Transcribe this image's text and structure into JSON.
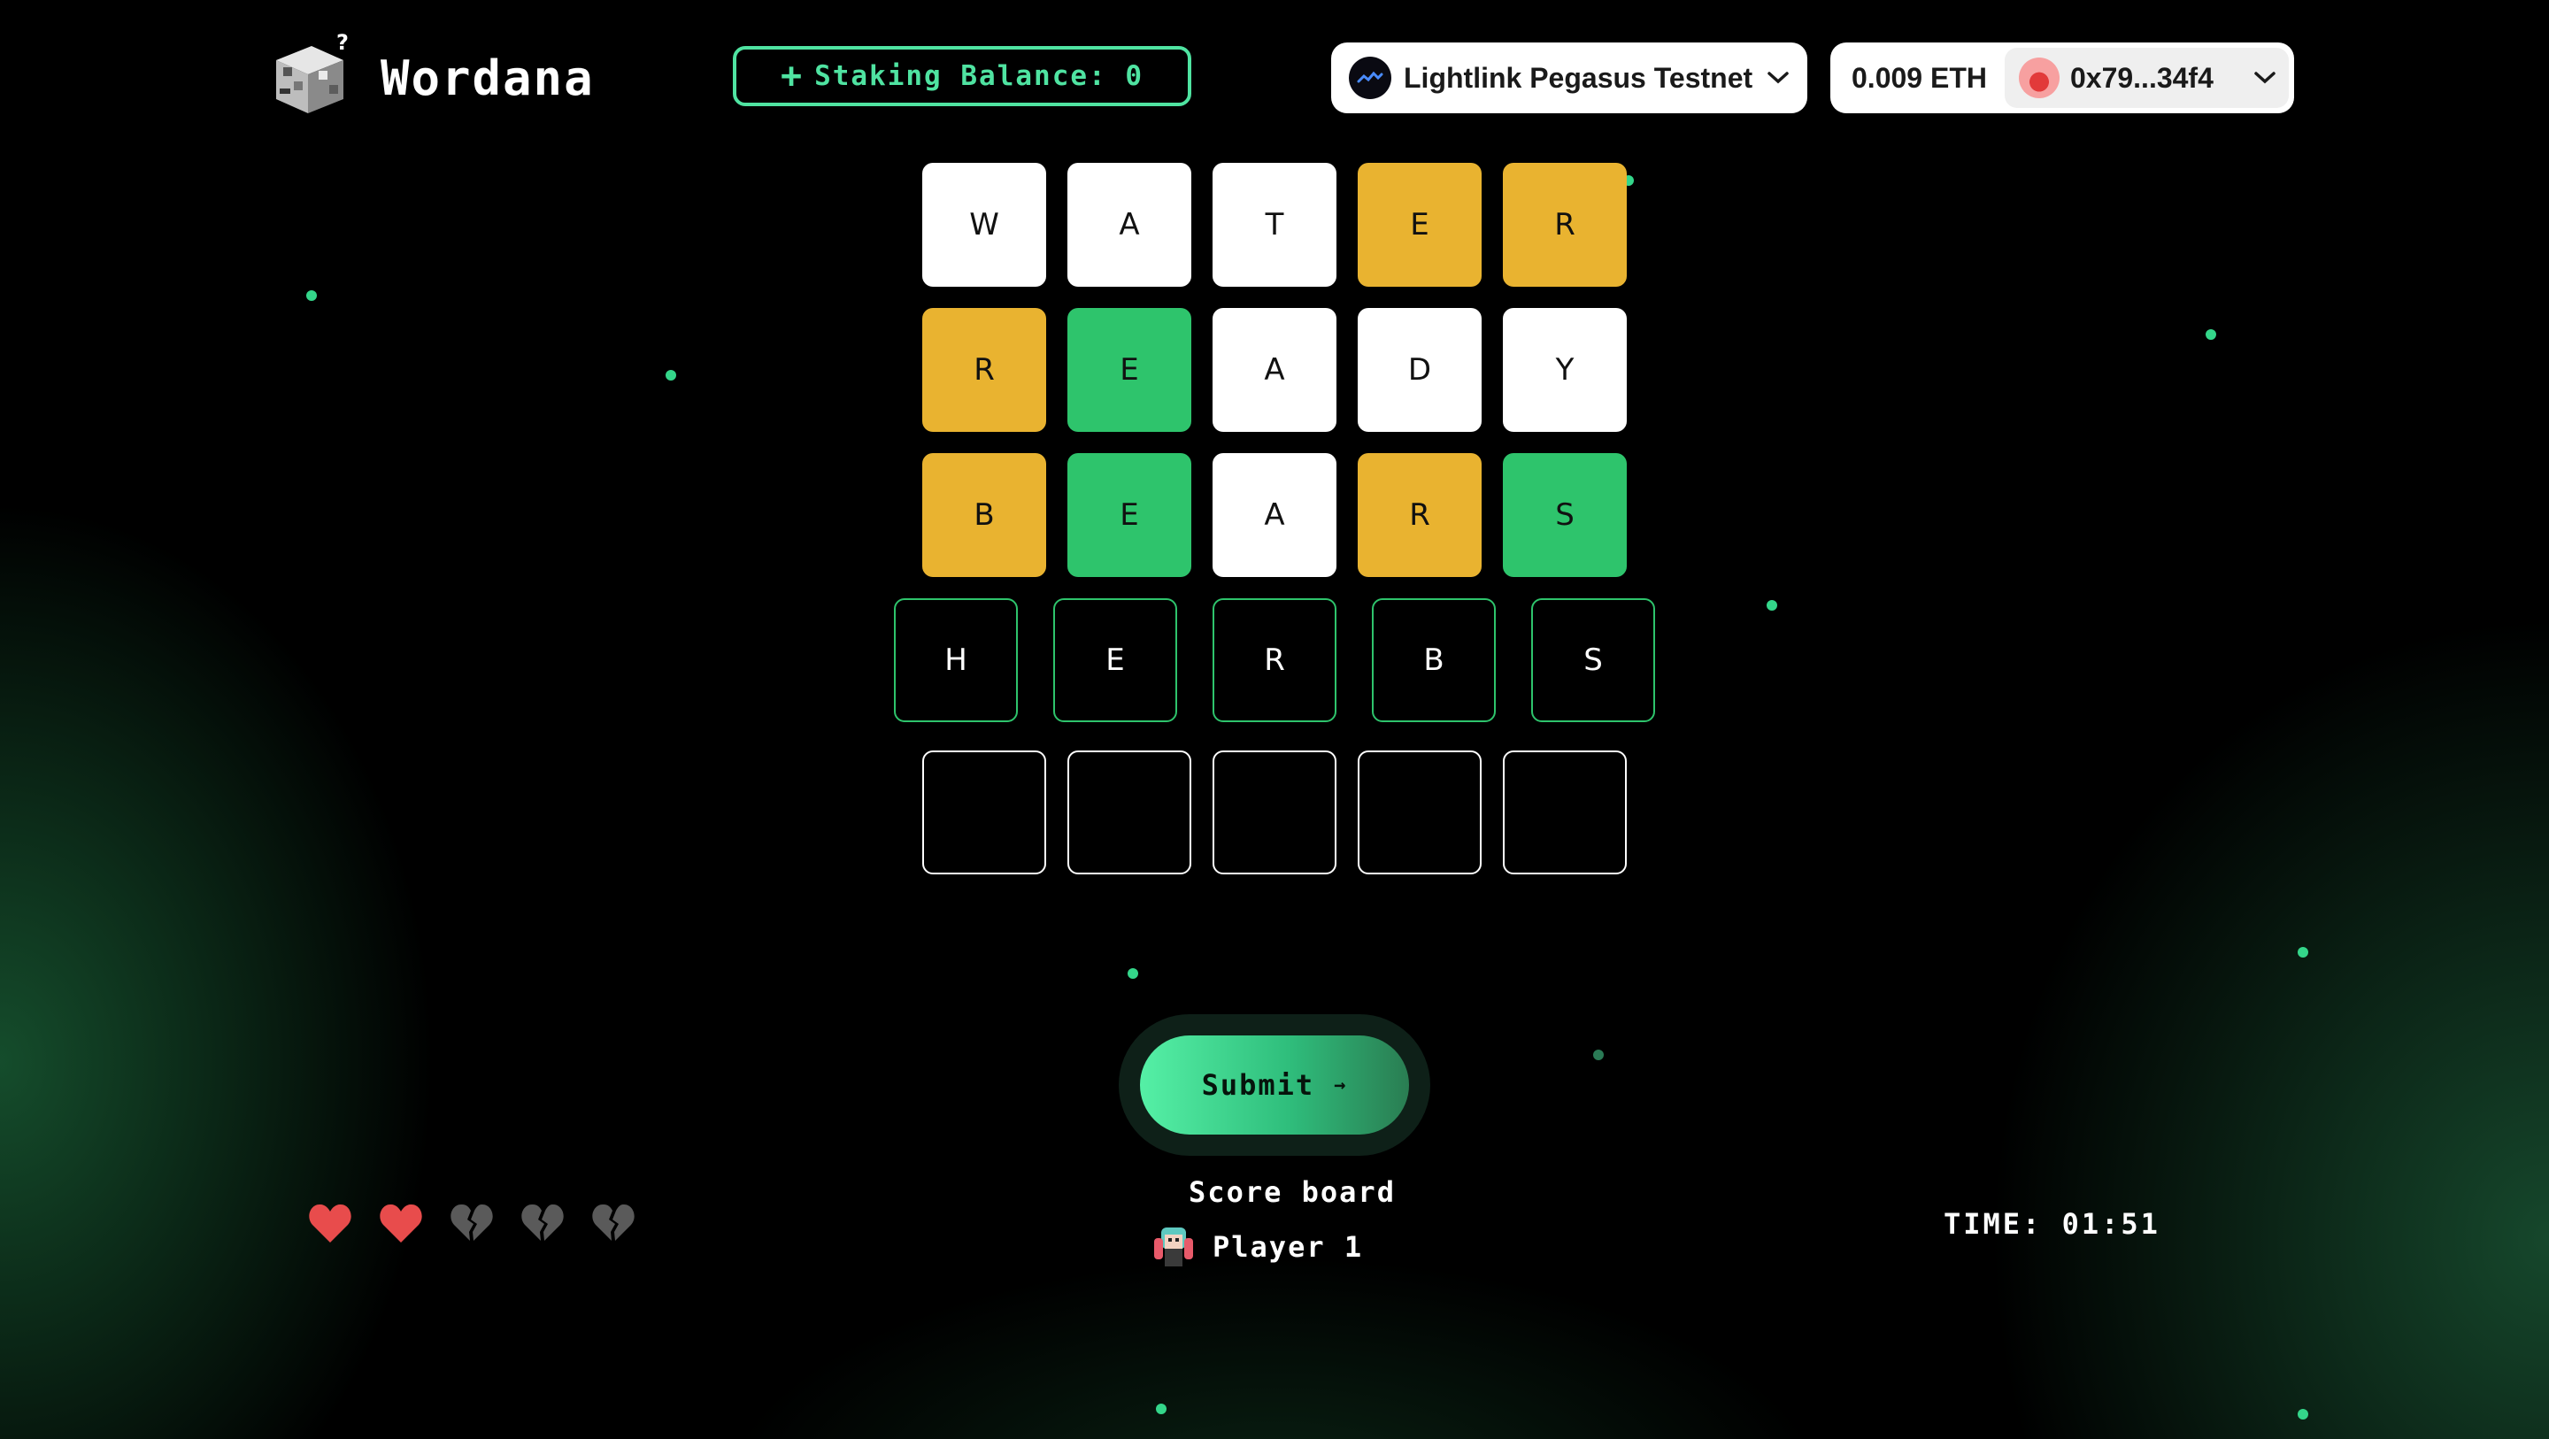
{
  "header": {
    "logo_text": "Wordana",
    "staking_label": "Staking Balance: 0",
    "network_name": "Lightlink Pegasus Testnet",
    "balance": "0.009 ETH",
    "account": "0x79...34f4"
  },
  "board": {
    "rows": [
      [
        {
          "letter": "W",
          "state": "white"
        },
        {
          "letter": "A",
          "state": "white"
        },
        {
          "letter": "T",
          "state": "white"
        },
        {
          "letter": "E",
          "state": "yellow"
        },
        {
          "letter": "R",
          "state": "yellow"
        }
      ],
      [
        {
          "letter": "R",
          "state": "yellow"
        },
        {
          "letter": "E",
          "state": "green"
        },
        {
          "letter": "A",
          "state": "white"
        },
        {
          "letter": "D",
          "state": "white"
        },
        {
          "letter": "Y",
          "state": "white"
        }
      ],
      [
        {
          "letter": "B",
          "state": "yellow"
        },
        {
          "letter": "E",
          "state": "green"
        },
        {
          "letter": "A",
          "state": "white"
        },
        {
          "letter": "R",
          "state": "yellow"
        },
        {
          "letter": "S",
          "state": "green"
        }
      ],
      [
        {
          "letter": "H",
          "state": "active"
        },
        {
          "letter": "E",
          "state": "active"
        },
        {
          "letter": "R",
          "state": "active"
        },
        {
          "letter": "B",
          "state": "active"
        },
        {
          "letter": "S",
          "state": "active"
        }
      ],
      [
        {
          "letter": "",
          "state": "empty"
        },
        {
          "letter": "",
          "state": "empty"
        },
        {
          "letter": "",
          "state": "empty"
        },
        {
          "letter": "",
          "state": "empty"
        },
        {
          "letter": "",
          "state": "empty"
        }
      ]
    ]
  },
  "submit": {
    "label": "Submit",
    "arrow": "→"
  },
  "scoreboard": {
    "title": "Score board",
    "player": "Player 1"
  },
  "lives": {
    "total": 5,
    "remaining": 2
  },
  "timer": {
    "label": "TIME: 01:51"
  },
  "colors": {
    "accent": "#4fe3a1",
    "correct": "#2ec46c",
    "present": "#e9b330",
    "absent": "#ffffff",
    "heart": "#e84c4c",
    "heart_lost": "#5a5a5a"
  },
  "icons": {
    "logo": "cube-question-icon",
    "network": "lightlink-icon",
    "account": "avatar-icon",
    "chevron": "chevron-down-icon",
    "heart": "heart-icon",
    "heart_broken": "broken-heart-icon"
  }
}
